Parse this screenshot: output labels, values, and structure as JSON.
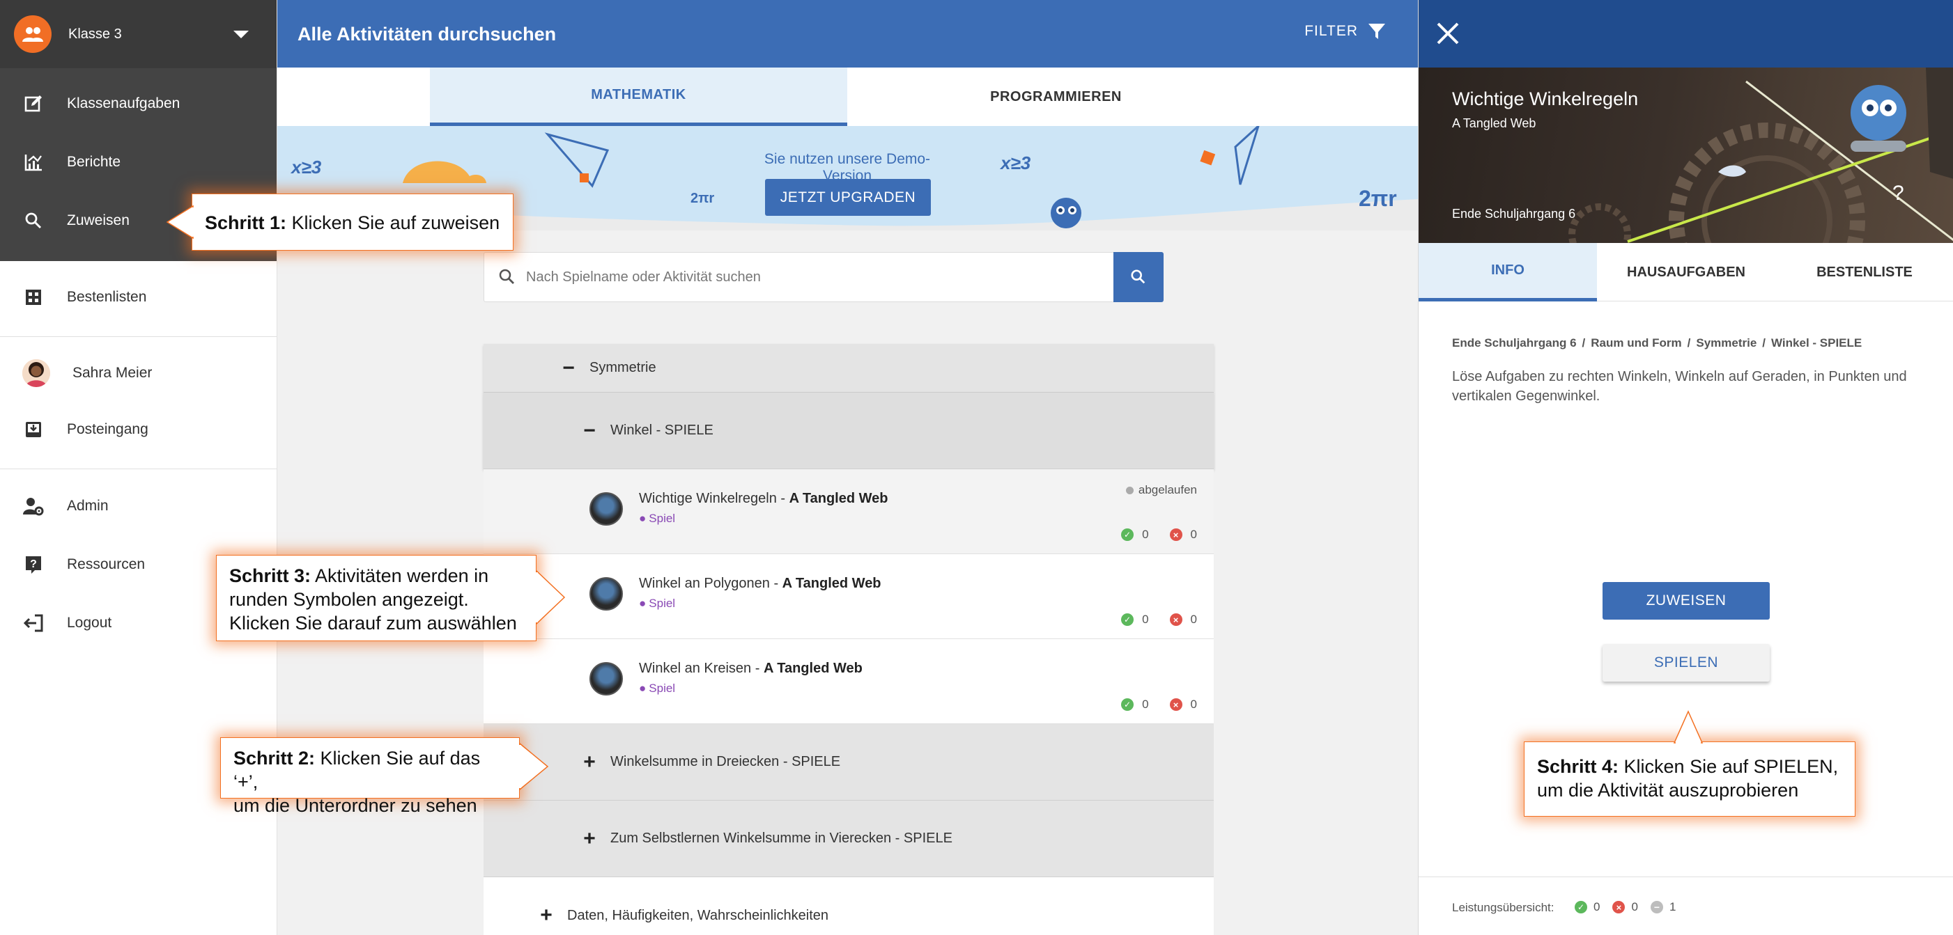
{
  "sidebar": {
    "class_name": "Klasse 3",
    "items_dark": [
      {
        "label": "Klassenaufgaben",
        "icon": "edit-icon"
      },
      {
        "label": "Berichte",
        "icon": "chart-icon"
      },
      {
        "label": "Zuweisen",
        "icon": "search-icon"
      }
    ],
    "items_light": [
      {
        "label": "Bestenlisten",
        "icon": "leaderboard-icon"
      },
      {
        "label": "Sahra Meier",
        "icon": "avatar"
      },
      {
        "label": "Posteingang",
        "icon": "inbox-icon"
      },
      {
        "label": "Admin",
        "icon": "admin-icon"
      },
      {
        "label": "Ressourcen",
        "icon": "help-icon"
      },
      {
        "label": "Logout",
        "icon": "logout-icon"
      }
    ]
  },
  "main": {
    "title": "Alle Aktivitäten durchsuchen",
    "filter_label": "FILTER",
    "tabs": [
      {
        "label": "MATHEMATIK",
        "active": true
      },
      {
        "label": "PROGRAMMIEREN",
        "active": false
      }
    ],
    "banner": {
      "demo_text": "Sie nutzen unsere Demo-Version",
      "upgrade_label": "JETZT UPGRADEN",
      "deco_1": "x≥3",
      "deco_2": "2πr",
      "deco_3": "x≥3",
      "deco_4": "2πr"
    },
    "search_placeholder": "Nach Spielname oder Aktivität suchen",
    "tree": {
      "symmetrie": {
        "sign": "−",
        "label": "Symmetrie"
      },
      "winkel_spiele": {
        "sign": "−",
        "label": "Winkel - SPIELE"
      },
      "activities": [
        {
          "title": "Wichtige Winkelregeln - ",
          "game": "A Tangled Web",
          "type": "Spiel",
          "status": "abgelaufen",
          "correct": "0",
          "wrong": "0"
        },
        {
          "title": "Winkel an Polygonen - ",
          "game": "A Tangled Web",
          "type": "Spiel",
          "correct": "0",
          "wrong": "0"
        },
        {
          "title": "Winkel an Kreisen - ",
          "game": "A Tangled Web",
          "type": "Spiel",
          "correct": "0",
          "wrong": "0"
        }
      ],
      "winkelsumme": {
        "sign": "+",
        "label": "Winkelsumme in Dreiecken - SPIELE"
      },
      "selbstlernen": {
        "sign": "+",
        "label": "Zum Selbstlernen Winkelsumme in Vierecken - SPIELE"
      },
      "daten": {
        "sign": "+",
        "label": "Daten, Häufigkeiten, Wahrscheinlichkeiten"
      }
    }
  },
  "detail": {
    "title": "Wichtige Winkelregeln",
    "subtitle": "A Tangled Web",
    "grade": "Ende Schuljahrgang 6",
    "tabs": [
      "INFO",
      "HAUSAUFGABEN",
      "BESTENLISTE"
    ],
    "breadcrumb": [
      "Ende Schuljahrgang 6",
      "Raum und Form",
      "Symmetrie",
      "Winkel - SPIELE"
    ],
    "description": "Löse Aufgaben zu rechten Winkeln, Winkeln auf Geraden, in Punkten und vertikalen Gegenwinkel.",
    "assign_label": "ZUWEISEN",
    "play_label": "SPIELEN",
    "performance": {
      "label": "Leistungsübersicht:",
      "correct": "0",
      "wrong": "0",
      "skipped": "1"
    }
  },
  "callouts": {
    "step1": {
      "bold": "Schritt 1:",
      "text": " Klicken Sie auf zuweisen"
    },
    "step2": {
      "bold": "Schritt 2:",
      "text": " Klicken Sie auf das ‘+’,",
      "line2": "um die Unterordner zu sehen"
    },
    "step3": {
      "bold": "Schritt 3:",
      "text": " Aktivitäten werden in",
      "line2": "runden Symbolen angezeigt.",
      "line3": "Klicken Sie darauf zum auswählen"
    },
    "step4": {
      "bold": "Schritt 4:",
      "text": " Klicken Sie auf SPIELEN,",
      "line2": "um die Aktivität auszuprobieren"
    }
  },
  "colors": {
    "primary": "#3c6db5",
    "accent_orange": "#f16e25",
    "sidebar_dark": "#444444",
    "detail_header": "#204c8e"
  }
}
